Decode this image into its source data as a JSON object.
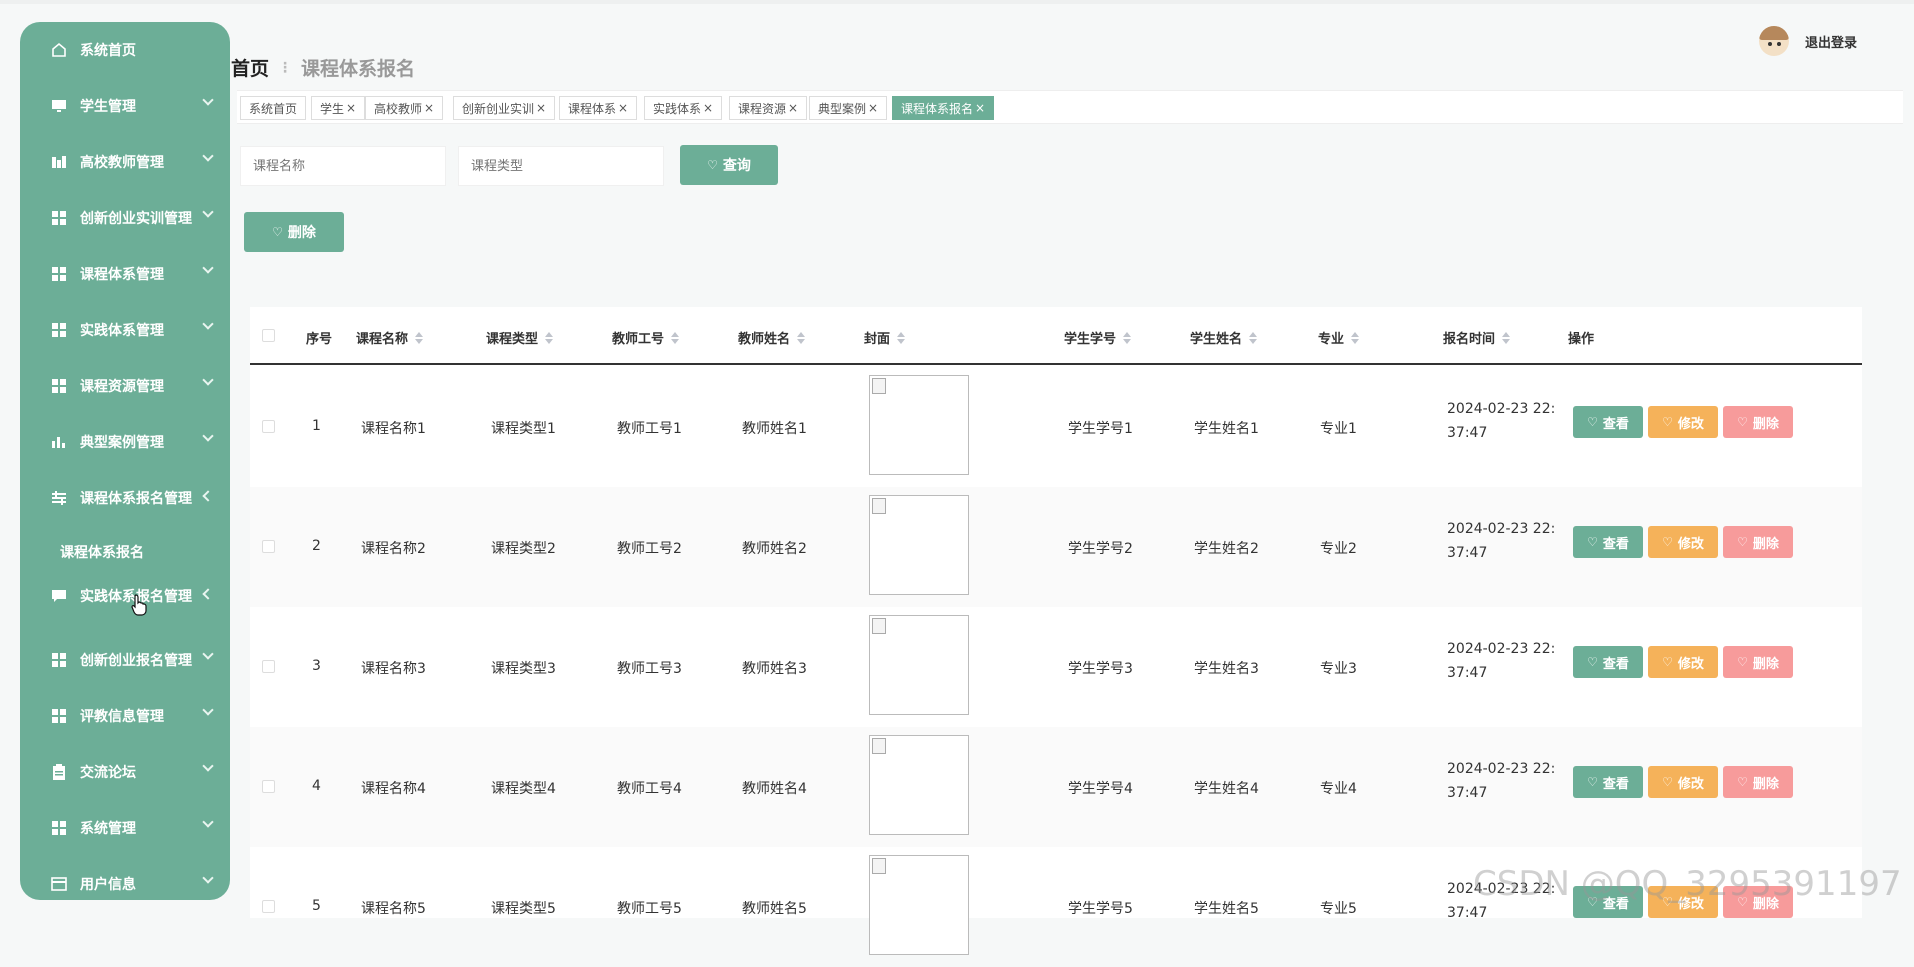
{
  "colors": {
    "accent": "#6cae97",
    "edit": "#f5b25a",
    "delete": "#f79b9b"
  },
  "sidebar": {
    "items": [
      {
        "label": "系统首页",
        "icon": "home-icon"
      },
      {
        "label": "学生管理",
        "icon": "monitor-icon"
      },
      {
        "label": "高校教师管理",
        "icon": "bar-icon"
      },
      {
        "label": "创新创业实训管理",
        "icon": "grid-icon"
      },
      {
        "label": "课程体系管理",
        "icon": "grid-icon"
      },
      {
        "label": "实践体系管理",
        "icon": "grid-icon"
      },
      {
        "label": "课程资源管理",
        "icon": "grid-icon"
      },
      {
        "label": "典型案例管理",
        "icon": "chart-icon"
      },
      {
        "label": "课程体系报名管理",
        "icon": "sliders-icon"
      },
      {
        "label": "实践体系报名管理",
        "icon": "message-icon"
      },
      {
        "label": "创新创业报名管理",
        "icon": "grid-icon"
      },
      {
        "label": "评教信息管理",
        "icon": "grid-icon"
      },
      {
        "label": "交流论坛",
        "icon": "clipboard-icon"
      },
      {
        "label": "系统管理",
        "icon": "grid-icon"
      },
      {
        "label": "用户信息",
        "icon": "card-icon"
      }
    ],
    "submenu": {
      "label": "课程体系报名"
    }
  },
  "breadcrumb": {
    "home": "首页",
    "separator": "⋮",
    "current": "课程体系报名"
  },
  "user": {
    "logout": "退出登录"
  },
  "tabs": [
    {
      "label": "系统首页",
      "close": ""
    },
    {
      "label": "学生",
      "close": "×"
    },
    {
      "label": "高校教师",
      "close": "×"
    },
    {
      "label": "创新创业实训",
      "close": "×"
    },
    {
      "label": "课程体系",
      "close": "×"
    },
    {
      "label": "实践体系",
      "close": "×"
    },
    {
      "label": "课程资源",
      "close": "×"
    },
    {
      "label": "典型案例",
      "close": "×"
    },
    {
      "label": "课程体系报名",
      "close": "×"
    }
  ],
  "search": {
    "name_placeholder": "课程名称",
    "type_placeholder": "课程类型",
    "query_label": "查询",
    "delete_label": "删除"
  },
  "table": {
    "headers": {
      "index": "序号",
      "course_name": "课程名称",
      "course_type": "课程类型",
      "teacher_id": "教师工号",
      "teacher_name": "教师姓名",
      "cover": "封面",
      "student_id": "学生学号",
      "student_name": "学生姓名",
      "major": "专业",
      "signup_time": "报名时间",
      "actions": "操作"
    },
    "rows": [
      {
        "index": "1",
        "course_name": "课程名称1",
        "course_type": "课程类型1",
        "teacher_id": "教师工号1",
        "teacher_name": "教师姓名1",
        "student_id": "学生学号1",
        "student_name": "学生姓名1",
        "major": "专业1",
        "time_line1": "2024-02-23 22:",
        "time_line2": "37:47"
      },
      {
        "index": "2",
        "course_name": "课程名称2",
        "course_type": "课程类型2",
        "teacher_id": "教师工号2",
        "teacher_name": "教师姓名2",
        "student_id": "学生学号2",
        "student_name": "学生姓名2",
        "major": "专业2",
        "time_line1": "2024-02-23 22:",
        "time_line2": "37:47"
      },
      {
        "index": "3",
        "course_name": "课程名称3",
        "course_type": "课程类型3",
        "teacher_id": "教师工号3",
        "teacher_name": "教师姓名3",
        "student_id": "学生学号3",
        "student_name": "学生姓名3",
        "major": "专业3",
        "time_line1": "2024-02-23 22:",
        "time_line2": "37:47"
      },
      {
        "index": "4",
        "course_name": "课程名称4",
        "course_type": "课程类型4",
        "teacher_id": "教师工号4",
        "teacher_name": "教师姓名4",
        "student_id": "学生学号4",
        "student_name": "学生姓名4",
        "major": "专业4",
        "time_line1": "2024-02-23 22:",
        "time_line2": "37:47"
      },
      {
        "index": "5",
        "course_name": "课程名称5",
        "course_type": "课程类型5",
        "teacher_id": "教师工号5",
        "teacher_name": "教师姓名5",
        "student_id": "学生学号5",
        "student_name": "学生姓名5",
        "major": "专业5",
        "time_line1": "2024-02-23 22:",
        "time_line2": "37:47"
      }
    ],
    "actions": {
      "view": "查看",
      "edit": "修改",
      "delete": "删除"
    }
  },
  "watermark": "CSDN @QQ_3295391197"
}
